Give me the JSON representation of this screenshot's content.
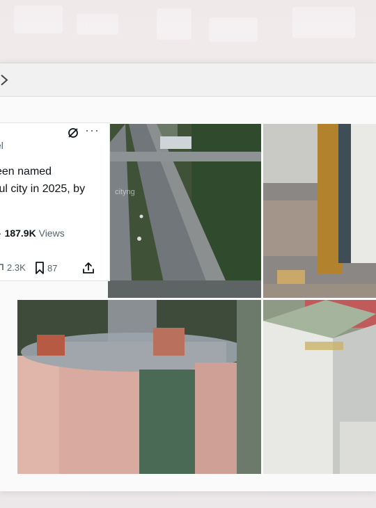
{
  "tweet": {
    "handle_fragment": "el",
    "text_lines": [
      "een named",
      "ful city in 2025, by"
    ],
    "views_count": "187.9K",
    "views_label": "Views",
    "stats_prefix": "·",
    "reposts": "2.3K",
    "bookmarks": "87"
  },
  "photos": [
    {
      "name": "highway-overpass-photo",
      "watermark": "cityng"
    },
    {
      "name": "gold-glass-tower-photo"
    },
    {
      "name": "circular-rooftop-complex-photo"
    },
    {
      "name": "office-block-aerial-photo"
    }
  ],
  "icons": {
    "forward": "chevron-right-icon",
    "grok": "grok-slash-circle-icon",
    "more": "more-dots-icon",
    "repost": "repost-icon",
    "bookmark": "bookmark-icon",
    "share": "share-icon"
  },
  "colors": {
    "text_primary": "#0f1419",
    "text_secondary": "#536471",
    "card_bg": "#ffffff",
    "window_bg": "#f6f6f6"
  }
}
